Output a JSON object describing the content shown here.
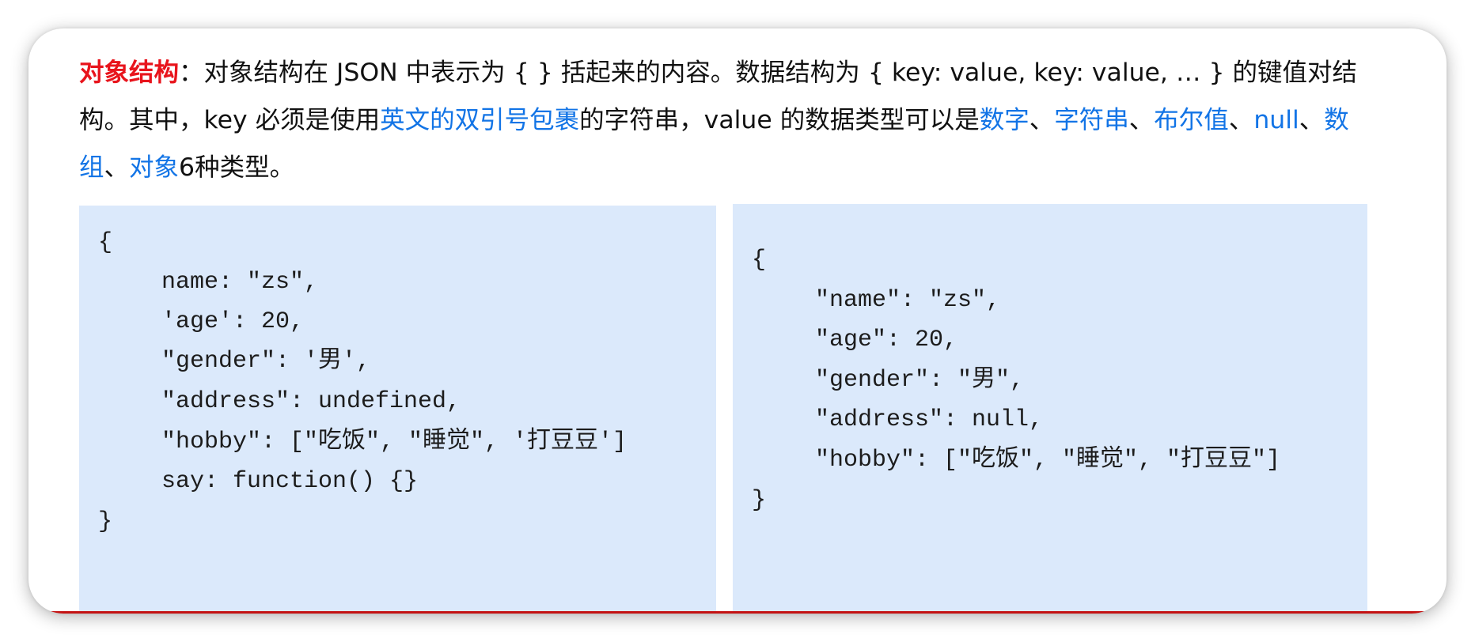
{
  "description": {
    "term": "对象结构",
    "text_1": "：对象结构在 JSON 中表示为 { } 括起来的内容。数据结构为 { key: value, key: value, … } 的键值对结构。其中，key 必须是使用",
    "highlight_quotes": "英文的双引号包裹",
    "text_2": "的字符串，value 的数据类型可以是",
    "type_number": "数字",
    "sep_1": "、",
    "type_string": "字符串",
    "sep_2": "、",
    "type_boolean": "布尔值",
    "sep_3": "、",
    "type_null": "null",
    "sep_4": "、",
    "type_array": "数组",
    "sep_5": "、",
    "type_object": "对象",
    "text_3": "6种类型。"
  },
  "left_code": {
    "lines": [
      "{",
      "name: \"zs\",",
      "'age': 20,",
      "\"gender\": '男',",
      "\"address\": undefined,",
      "\"hobby\": [\"吃饭\", \"睡觉\", '打豆豆']",
      "say: function() {}",
      "}"
    ]
  },
  "right_code": {
    "lines": [
      "{",
      "\"name\": \"zs\",",
      "\"age\": 20,",
      "\"gender\": \"男\",",
      "\"address\": null,",
      "\"hobby\": [\"吃饭\", \"睡觉\", \"打豆豆\"]",
      "}"
    ]
  },
  "colors": {
    "term": "#e8141c",
    "highlight": "#1274e6",
    "code_background": "#dbe9fb",
    "bottom_line": "#c41212"
  }
}
